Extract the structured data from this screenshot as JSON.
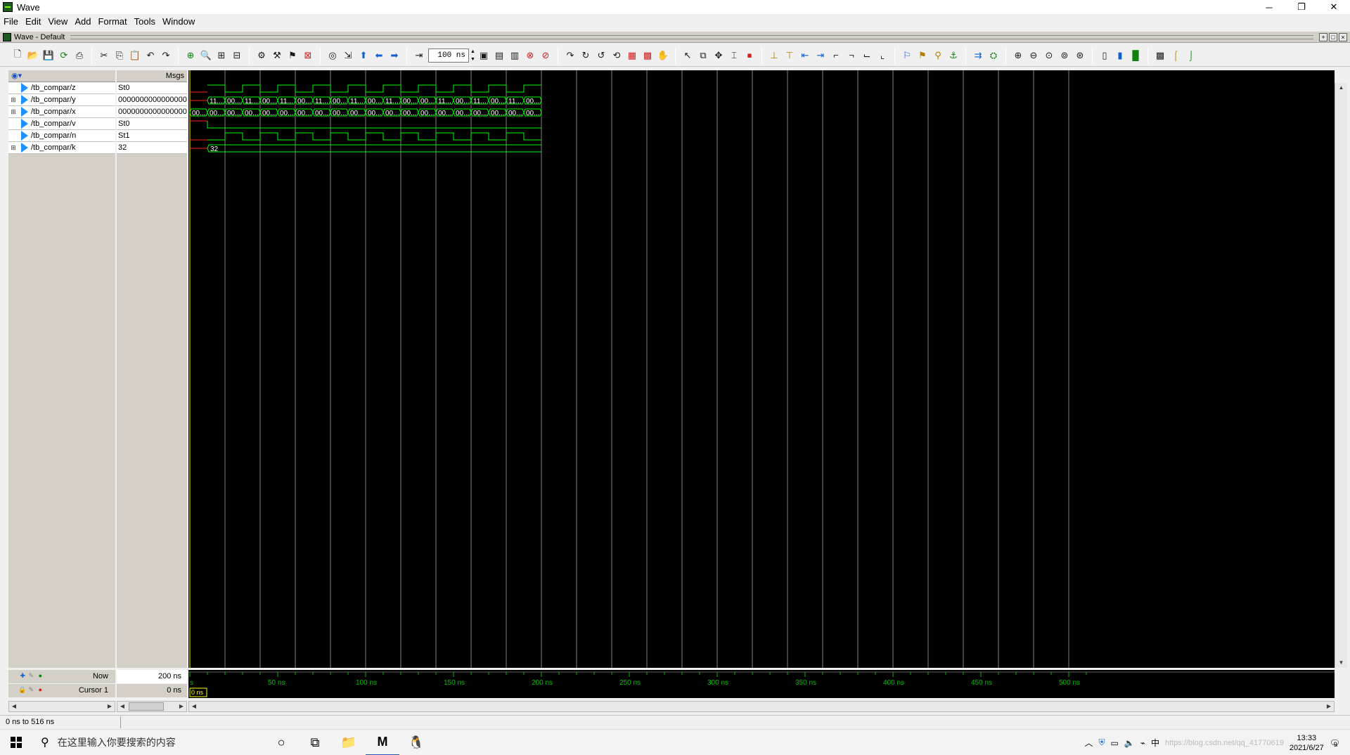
{
  "window": {
    "title": "Wave",
    "min": "─",
    "restore": "❐",
    "close": "✕"
  },
  "menu": [
    "File",
    "Edit",
    "View",
    "Add",
    "Format",
    "Tools",
    "Window"
  ],
  "wave_header": {
    "title": "Wave - Default"
  },
  "toolbar": {
    "time_step": "100 ns"
  },
  "columns": {
    "msgs": "Msgs"
  },
  "signals": [
    {
      "name": "/tb_compar/z",
      "value": "St0",
      "expandable": false
    },
    {
      "name": "/tb_compar/y",
      "value": "00000000000000000",
      "expandable": true
    },
    {
      "name": "/tb_compar/x",
      "value": "00000000000000000",
      "expandable": true
    },
    {
      "name": "/tb_compar/v",
      "value": "St0",
      "expandable": false
    },
    {
      "name": "/tb_compar/n",
      "value": "St1",
      "expandable": false
    },
    {
      "name": "/tb_compar/k",
      "value": "32",
      "expandable": true
    }
  ],
  "cursor_panel": {
    "now_label": "Now",
    "now_value": "200 ns",
    "cursor_label": "Cursor 1",
    "cursor_value": "0 ns",
    "cursor_marker": "0 ns"
  },
  "time_axis": {
    "ticks": [
      "s",
      "50 ns",
      "100 ns",
      "150 ns",
      "200 ns",
      "250 ns",
      "300 ns",
      "350 ns",
      "400 ns",
      "450 ns",
      "500 ns"
    ]
  },
  "waves": {
    "y_labels": [
      "11...",
      "00...",
      "11...",
      "00...",
      "11...",
      "00...",
      "11...",
      "00...",
      "11...",
      "00...",
      "11...",
      "00...",
      "00...",
      "11...",
      "00...",
      "11...",
      "00...",
      "11...",
      "00...",
      "11..."
    ],
    "x_labels": [
      "00...",
      "00...",
      "00...",
      "00...",
      "00...",
      "00...",
      "00...",
      "00...",
      "00...",
      "00...",
      "00...",
      "00...",
      "00...",
      "00...",
      "00...",
      "00...",
      "00...",
      "00...",
      "00...",
      "00..."
    ],
    "k_label": "32"
  },
  "status": {
    "range": "0 ns to 516 ns"
  },
  "taskbar": {
    "search_placeholder": "在这里输入你要搜索的内容",
    "clock_time": "13:33",
    "clock_date": "2021/6/27",
    "ime": "中",
    "notification_count": "9",
    "watermark": "https://blog.csdn.net/qq_41770619"
  },
  "colors": {
    "wave_green": "#00ff00",
    "wave_red": "#ff2020",
    "cursor_yellow": "#ffff00",
    "grid": "#808080",
    "axis_green": "#00c000"
  }
}
